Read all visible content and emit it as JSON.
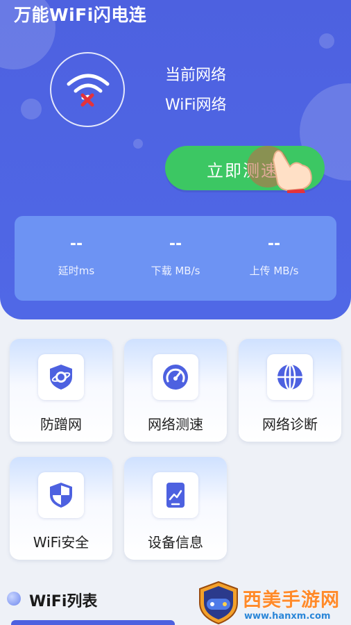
{
  "header": {
    "app_title": "万能WiFi闪电连",
    "network_label": "当前网络",
    "network_name": "WiFi网络",
    "speed_test_button": "立即测速"
  },
  "stats": [
    {
      "value": "--",
      "label": "延时ms"
    },
    {
      "value": "--",
      "label": "下载 MB/s"
    },
    {
      "value": "--",
      "label": "上传 MB/s"
    }
  ],
  "tiles": [
    {
      "label": "防蹭网",
      "icon": "shield-planet-icon"
    },
    {
      "label": "网络测速",
      "icon": "speedometer-icon"
    },
    {
      "label": "网络诊断",
      "icon": "globe-icon"
    },
    {
      "label": "WiFi安全",
      "icon": "security-shield-icon"
    },
    {
      "label": "设备信息",
      "icon": "device-chart-icon"
    }
  ],
  "wifi_list": {
    "title": "WiFi列表"
  },
  "watermark": {
    "brand": "西美手游网",
    "url": "www.hanxm.com"
  },
  "colors": {
    "primary": "#4d61e0",
    "button_green": "#3cc763",
    "stats_panel": "#6d93f3",
    "watermark_orange": "#ff8a2a"
  }
}
